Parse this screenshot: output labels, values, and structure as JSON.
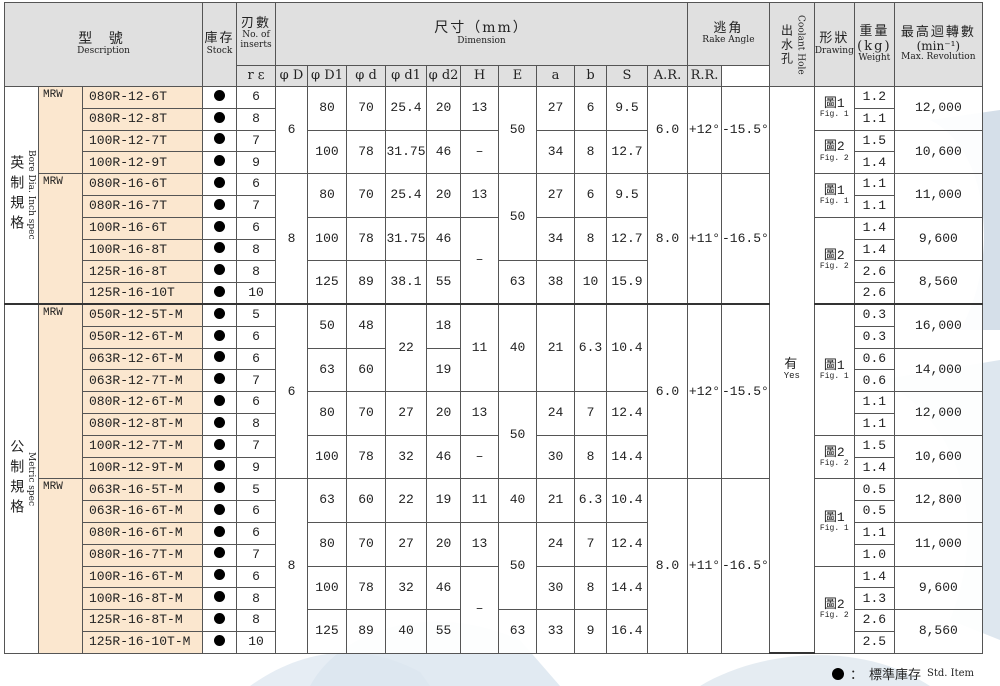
{
  "header": {
    "model_zh": "型 號",
    "model_en": "Description",
    "stock_zh": "庫存",
    "stock_en": "Stock",
    "inserts_zh": "刃數",
    "inserts_en": "No. of inserts",
    "dim_zh": "尺寸（mm）",
    "dim_en": "Dimension",
    "rake_zh": "逃角",
    "rake_en": "Rake Angle",
    "coolant_zh": "出水孔",
    "coolant_en": "Coolant Hole",
    "shape_zh": "形狀",
    "shape_en": "Drawing",
    "weight_zh": "重量(kg)",
    "weight_en": "Weight",
    "maxrev_zh": "最高迴轉數",
    "maxrev_unit": "(min⁻¹)",
    "maxrev_en": "Max. Revolution",
    "cols": [
      "r ε",
      "φ D",
      "φ D1",
      "φ d",
      "φ d1",
      "φ d2",
      "H",
      "E",
      "a",
      "b",
      "S",
      "A.R.",
      "R.R."
    ]
  },
  "sys_inch": {
    "zh": "英制規格",
    "en": "Bore Dia. Inch spec"
  },
  "sys_metric": {
    "zh": "公制規格",
    "en": "Metric spec"
  },
  "prefix": "MRW",
  "coolant": {
    "zh": "有",
    "en": "Yes"
  },
  "fig1": {
    "zh": "圖1",
    "en": "Fig. 1"
  },
  "fig2": {
    "zh": "圖2",
    "en": "Fig. 2"
  },
  "rows": [
    {
      "model": "080R-12-6T",
      "inserts": "6",
      "weight": "1.2"
    },
    {
      "model": "080R-12-8T",
      "inserts": "8",
      "weight": "1.1"
    },
    {
      "model": "100R-12-7T",
      "inserts": "7",
      "weight": "1.5"
    },
    {
      "model": "100R-12-9T",
      "inserts": "9",
      "weight": "1.4"
    },
    {
      "model": "080R-16-6T",
      "inserts": "6",
      "weight": "1.1"
    },
    {
      "model": "080R-16-7T",
      "inserts": "7",
      "weight": "1.1"
    },
    {
      "model": "100R-16-6T",
      "inserts": "6",
      "weight": "1.4"
    },
    {
      "model": "100R-16-8T",
      "inserts": "8",
      "weight": "1.4"
    },
    {
      "model": "125R-16-8T",
      "inserts": "8",
      "weight": "2.6"
    },
    {
      "model": "125R-16-10T",
      "inserts": "10",
      "weight": "2.6"
    },
    {
      "model": "050R-12-5T-M",
      "inserts": "5",
      "weight": "0.3"
    },
    {
      "model": "050R-12-6T-M",
      "inserts": "6",
      "weight": "0.3"
    },
    {
      "model": "063R-12-6T-M",
      "inserts": "6",
      "weight": "0.6"
    },
    {
      "model": "063R-12-7T-M",
      "inserts": "7",
      "weight": "0.6"
    },
    {
      "model": "080R-12-6T-M",
      "inserts": "6",
      "weight": "1.1"
    },
    {
      "model": "080R-12-8T-M",
      "inserts": "8",
      "weight": "1.1"
    },
    {
      "model": "100R-12-7T-M",
      "inserts": "7",
      "weight": "1.5"
    },
    {
      "model": "100R-12-9T-M",
      "inserts": "9",
      "weight": "1.4"
    },
    {
      "model": "063R-16-5T-M",
      "inserts": "5",
      "weight": "0.5"
    },
    {
      "model": "063R-16-6T-M",
      "inserts": "6",
      "weight": "0.5"
    },
    {
      "model": "080R-16-6T-M",
      "inserts": "6",
      "weight": "1.1"
    },
    {
      "model": "080R-16-7T-M",
      "inserts": "7",
      "weight": "1.0"
    },
    {
      "model": "100R-16-6T-M",
      "inserts": "6",
      "weight": "1.4"
    },
    {
      "model": "100R-16-8T-M",
      "inserts": "8",
      "weight": "1.3"
    },
    {
      "model": "125R-16-8T-M",
      "inserts": "8",
      "weight": "2.6"
    },
    {
      "model": "125R-16-10T-M",
      "inserts": "10",
      "weight": "2.5"
    }
  ],
  "pairs": [
    {
      "D": "80",
      "D1": "70",
      "d": "25.4",
      "d1": "20",
      "d2": "13",
      "E": "27",
      "a": "6",
      "b": "9.5",
      "rev": "12,000"
    },
    {
      "D": "100",
      "D1": "78",
      "d": "31.75",
      "d1": "46",
      "d2": "–",
      "E": "34",
      "a": "8",
      "b": "12.7",
      "rev": "10,600"
    },
    {
      "D": "80",
      "D1": "70",
      "d": "25.4",
      "d1": "20",
      "d2": "13",
      "E": "27",
      "a": "6",
      "b": "9.5",
      "rev": "11,000"
    },
    {
      "D": "100",
      "D1": "78",
      "d": "31.75",
      "d1": "46",
      "E": "34",
      "a": "8",
      "b": "12.7"
    },
    {
      "D": "125",
      "D1": "89",
      "d": "38.1",
      "d1": "55",
      "H": "63",
      "E": "38",
      "a": "10",
      "b": "15.9",
      "rev": "8,560"
    },
    {
      "D": "50",
      "D1": "48",
      "d1": "18",
      "rev": "16,000"
    },
    {
      "D": "63",
      "D1": "60",
      "d1": "19",
      "rev": "14,000"
    },
    {
      "D": "80",
      "D1": "70",
      "d": "27",
      "d1": "20",
      "d2": "13",
      "E": "24",
      "a": "7",
      "b": "12.4",
      "rev": "12,000"
    },
    {
      "D": "100",
      "D1": "78",
      "d": "32",
      "d1": "46",
      "d2": "–",
      "E": "30",
      "a": "8",
      "b": "14.4",
      "rev": "10,600"
    },
    {
      "D": "63",
      "D1": "60",
      "d": "22",
      "d1": "19",
      "d2": "11",
      "H": "40",
      "E": "21",
      "a": "6.3",
      "b": "10.4",
      "rev": "12,800"
    },
    {
      "D": "80",
      "D1": "70",
      "d": "27",
      "d1": "20",
      "d2": "13",
      "E": "24",
      "a": "7",
      "b": "12.4",
      "rev": "11,000"
    },
    {
      "D": "100",
      "D1": "78",
      "d": "32",
      "d1": "46",
      "E": "30",
      "a": "8",
      "b": "14.4",
      "rev": "9,600"
    },
    {
      "D": "125",
      "D1": "89",
      "d": "40",
      "d1": "55",
      "H": "63",
      "E": "33",
      "a": "9",
      "b": "16.4",
      "rev": "8,560"
    }
  ],
  "spans": {
    "re_inch1": "6",
    "re_inch2": "8",
    "re_met1": "6",
    "re_met2": "8",
    "h_inch1": "50",
    "h_inch2": "50",
    "h_met_a": "40",
    "h_met_b": "50",
    "h_met2": "50",
    "d2_inch2": "–",
    "d2_met2": "–",
    "d_met1": "22",
    "d2_met1": "11",
    "e_met1": "21",
    "a_met1": "6.3",
    "b_met1": "10.4",
    "s_6": "6.0",
    "s_8": "8.0",
    "ar_6": "+12°",
    "rr_6": "-15.5°",
    "ar_8": "+11°",
    "rr_8": "-16.5°",
    "rev_inch_b": "9,600"
  },
  "legend": {
    "zh": "標準庫存",
    "en": "Std. Item",
    "sep": "："
  }
}
